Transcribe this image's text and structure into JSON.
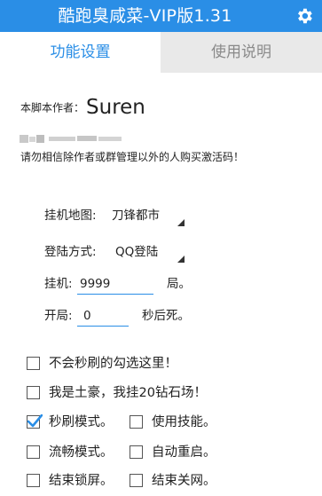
{
  "header": {
    "title": "酷跑臭咸菜-VIP版1.31",
    "gear_icon": "gear-icon",
    "color": "#2a8ee6"
  },
  "tabs": [
    {
      "label": "功能设置",
      "active": true
    },
    {
      "label": "使用说明",
      "active": false
    }
  ],
  "author": {
    "label": "本脚本作者：",
    "name": "Suren"
  },
  "warning": "请勿相信除作者或群管理以外的人购买激活码！",
  "settings": {
    "map": {
      "label": "挂机地图:",
      "value": "刀锋都市"
    },
    "login": {
      "label": "登陆方式:",
      "value": "QQ登陆"
    },
    "hangup": {
      "label": "挂机:",
      "value": "9999",
      "suffix": "局。"
    },
    "start": {
      "label": "开局:",
      "value": "0",
      "suffix": "秒后死。"
    }
  },
  "checkboxes": {
    "no_flash": {
      "label": "不会秒刷的勾选这里！",
      "checked": false
    },
    "rich": {
      "label": "我是土豪，我挂20钻石场！",
      "checked": false
    },
    "flash_mode": {
      "label": "秒刷模式。",
      "checked": true
    },
    "use_skill": {
      "label": "使用技能。",
      "checked": false
    },
    "smooth_mode": {
      "label": "流畅模式。",
      "checked": false
    },
    "auto_restart": {
      "label": "自动重启。",
      "checked": false
    },
    "lock_screen": {
      "label": "结束锁屏。",
      "checked": false
    },
    "close_network": {
      "label": "结束关网。",
      "checked": false
    }
  }
}
